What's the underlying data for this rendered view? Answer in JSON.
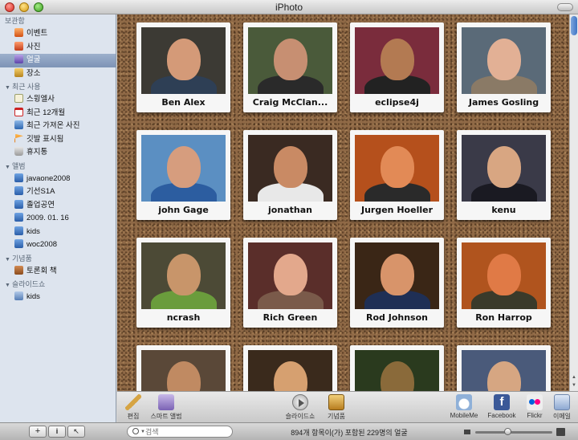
{
  "window": {
    "title": "iPhoto"
  },
  "sidebar": {
    "sections": [
      {
        "title": "보관함",
        "collapsible": false,
        "items": [
          {
            "label": "이벤트",
            "icon": "events-icon",
            "selected": false
          },
          {
            "label": "사진",
            "icon": "photos-icon",
            "selected": false
          },
          {
            "label": "얼굴",
            "icon": "faces-icon",
            "selected": true
          },
          {
            "label": "장소",
            "icon": "places-icon",
            "selected": false
          }
        ]
      },
      {
        "title": "최근 사용",
        "collapsible": true,
        "items": [
          {
            "label": "스윙엘사",
            "icon": "slideshow-icon",
            "selected": false
          },
          {
            "label": "최근 12개월",
            "icon": "calendar-icon",
            "selected": false
          },
          {
            "label": "최근 가져온 사진",
            "icon": "import-icon",
            "selected": false
          },
          {
            "label": "깃발 표시됨",
            "icon": "flag-icon",
            "selected": false
          },
          {
            "label": "휴지통",
            "icon": "trash-icon",
            "selected": false
          }
        ]
      },
      {
        "title": "앨범",
        "collapsible": true,
        "items": [
          {
            "label": "javaone2008",
            "icon": "album-icon",
            "selected": false
          },
          {
            "label": "기선S1A",
            "icon": "album-icon",
            "selected": false
          },
          {
            "label": "졸업공연",
            "icon": "album-icon",
            "selected": false
          },
          {
            "label": "2009. 01. 16",
            "icon": "album-icon",
            "selected": false
          },
          {
            "label": "kids",
            "icon": "album-icon",
            "selected": false
          },
          {
            "label": "woc2008",
            "icon": "album-icon",
            "selected": false
          }
        ]
      },
      {
        "title": "기념품",
        "collapsible": true,
        "items": [
          {
            "label": "토론회 책",
            "icon": "book-icon",
            "selected": false
          }
        ]
      },
      {
        "title": "슬라이드쇼",
        "collapsible": true,
        "items": [
          {
            "label": "kids",
            "icon": "slideshow-project-icon",
            "selected": false
          }
        ]
      }
    ]
  },
  "faces": [
    {
      "name": "Ben Alex",
      "bg": "#3c3a34",
      "skin": "#d49a78",
      "shirt": "#2e3f55"
    },
    {
      "name": "Craig McClan...",
      "bg": "#4a5a3a",
      "skin": "#c78f72",
      "shirt": "#2a2a2a"
    },
    {
      "name": "eclipse4j",
      "bg": "#7a2c3c",
      "skin": "#b37a52",
      "shirt": "#222222"
    },
    {
      "name": "James Gosling",
      "bg": "#5a6a78",
      "skin": "#e2b095",
      "shirt": "#8a7a66"
    },
    {
      "name": "john Gage",
      "bg": "#5b8fc2",
      "skin": "#d69d7e",
      "shirt": "#2c5da0"
    },
    {
      "name": "jonathan",
      "bg": "#3a2a22",
      "skin": "#c98a64",
      "shirt": "#e8e8e8"
    },
    {
      "name": "Jurgen Hoeller",
      "bg": "#b5501c",
      "skin": "#e28a56",
      "shirt": "#2a2a2a"
    },
    {
      "name": "kenu",
      "bg": "#3a3a48",
      "skin": "#d8a682",
      "shirt": "#1a1a22"
    },
    {
      "name": "ncrash",
      "bg": "#4c4a36",
      "skin": "#c8956a",
      "shirt": "#6a9c3c"
    },
    {
      "name": "Rich Green",
      "bg": "#5a2e2a",
      "skin": "#e3a88c",
      "shirt": "#7a5a4a"
    },
    {
      "name": "Rod Johnson",
      "bg": "#3a2616",
      "skin": "#d8946a",
      "shirt": "#1f2f55"
    },
    {
      "name": "Ron Harrop",
      "bg": "#b0541e",
      "skin": "#e07a46",
      "shirt": "#3a3a2a"
    },
    {
      "name": "",
      "bg": "#5a4838",
      "skin": "#c08a62",
      "shirt": "#2a2a2a"
    },
    {
      "name": "",
      "bg": "#3a2a1c",
      "skin": "#d6a070",
      "shirt": "#2a2a2a"
    },
    {
      "name": "",
      "bg": "#2a3a1e",
      "skin": "#8a6a3a",
      "shirt": "#1a1a1a"
    },
    {
      "name": "",
      "bg": "#4a5a7a",
      "skin": "#d6a682",
      "shirt": "#2a2a2a"
    }
  ],
  "tools": {
    "edit": "편집",
    "smart_album": "스마트 앨범",
    "slideshow": "슬라이드쇼",
    "keepsakes": "기념품",
    "mobileme": "MobileMe",
    "facebook": "Facebook",
    "flickr": "Flickr",
    "email": "이메일"
  },
  "statusbar": {
    "add_label": "+",
    "info_label": "i",
    "fullscreen_label": "↖",
    "search_placeholder": "검색",
    "status": "894개 항목이(가) 포함된 229명의 얼굴",
    "zoom_level": 0.42
  },
  "colors": {
    "selection": "#7d93b6",
    "cork": "#8f6946"
  }
}
